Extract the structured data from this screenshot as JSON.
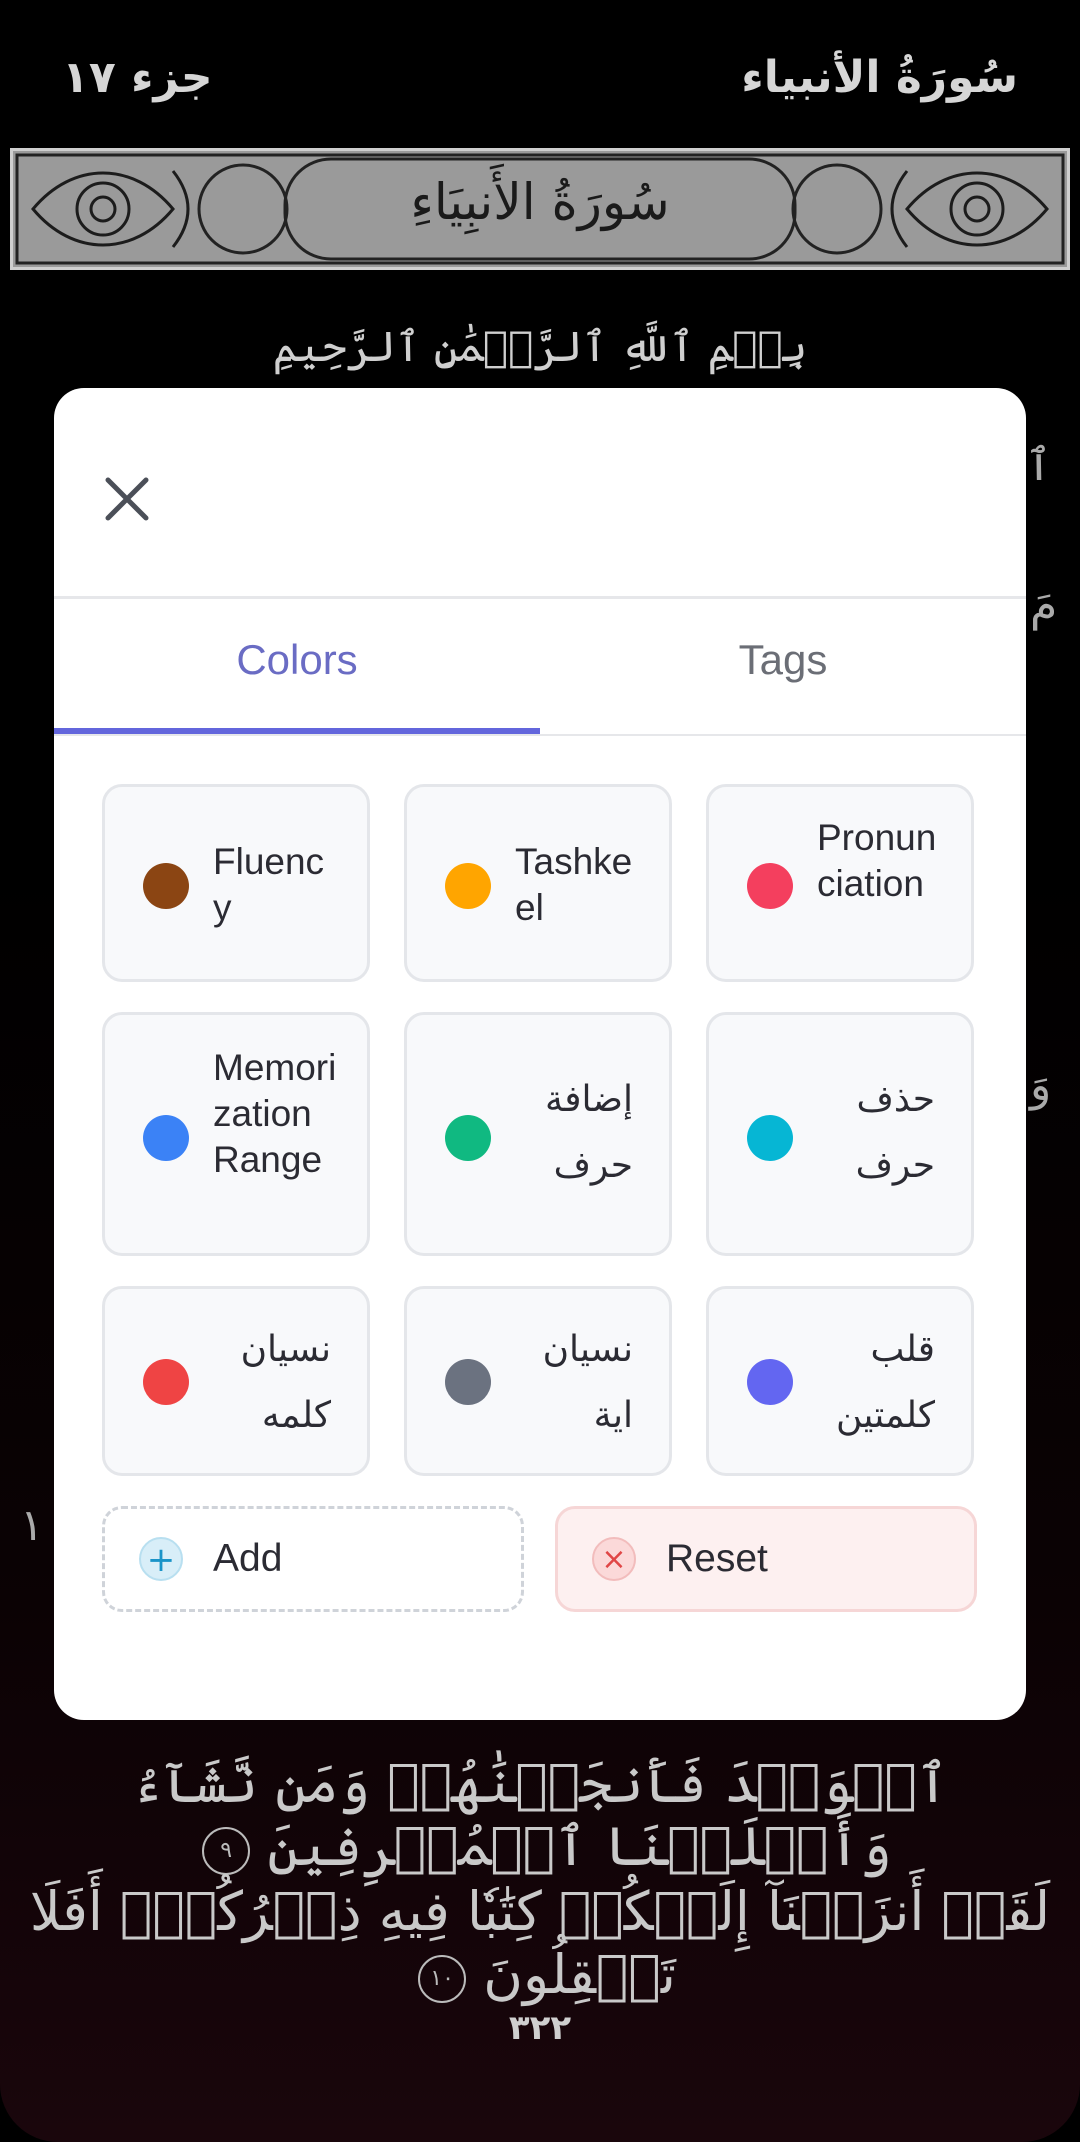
{
  "header": {
    "juz": "جزء ١٧",
    "surah": "سُورَةُ الأنبياء"
  },
  "banner": {
    "title": "سُورَةُ الأَنبِيَاءِ"
  },
  "basmala": "بِسۡمِ ٱللَّهِ ٱلرَّحۡمَٰنِ ٱلرَّحِيمِ",
  "verses": [
    {
      "text": "ٱلۡوَعۡدَ فَأَنجَيۡنَٰهُمۡ وَمَن نَّشَآءُ وَأَهۡلَكۡنَا ٱلۡمُسۡرِفِينَ",
      "marker": "٩"
    },
    {
      "text": "لَقَدۡ أَنزَلۡنَآ إِلَيۡكُمۡ كِتَٰبٗا فِيهِ ذِكۡرُكُمۡۚ أَفَلَا تَعۡقِلُونَ",
      "marker": "١٠"
    }
  ],
  "page_number": "٣٢٢",
  "modal": {
    "tabs": [
      {
        "label": "Colors",
        "active": true
      },
      {
        "label": "Tags",
        "active": false
      }
    ],
    "accent_color": "#6366dc",
    "colors": [
      {
        "label": "Fluency",
        "color": "#8b4513"
      },
      {
        "label": "Tashkeel",
        "color": "#ffa500"
      },
      {
        "label": "Pronunciation",
        "color": "#f43f5e"
      },
      {
        "label": "Memorization Range",
        "color": "#3b82f6"
      },
      {
        "label": "إضافة حرف",
        "color": "#10b981"
      },
      {
        "label": "حذف حرف",
        "color": "#06b6d4"
      },
      {
        "label": "نسيان كلمه",
        "color": "#ef4444"
      },
      {
        "label": "نسيان اية",
        "color": "#6b7280"
      },
      {
        "label": "قلب كلمتين",
        "color": "#6366f1"
      }
    ],
    "add_label": "Add",
    "reset_label": "Reset"
  }
}
